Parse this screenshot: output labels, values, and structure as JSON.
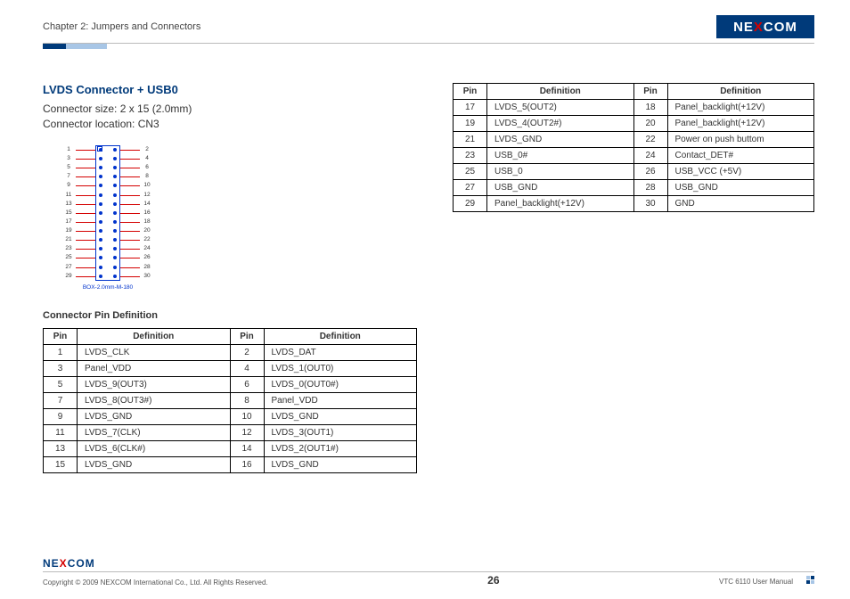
{
  "header": {
    "chapter": "Chapter 2: Jumpers and Connectors",
    "logo": "NEXCOM"
  },
  "section": {
    "title": "LVDS Connector + USB0",
    "size_line": "Connector size:  2 x 15 (2.0mm)",
    "loc_line": "Connector location: CN3",
    "diagram_label": "BOX-2.0mm-M-180",
    "pin_def_title": "Connector Pin Definition"
  },
  "table_headers": {
    "pin": "Pin",
    "def": "Definition"
  },
  "table1": [
    {
      "p1": "1",
      "d1": "LVDS_CLK",
      "p2": "2",
      "d2": "LVDS_DAT"
    },
    {
      "p1": "3",
      "d1": "Panel_VDD",
      "p2": "4",
      "d2": "LVDS_1(OUT0)"
    },
    {
      "p1": "5",
      "d1": "LVDS_9(OUT3)",
      "p2": "6",
      "d2": "LVDS_0(OUT0#)"
    },
    {
      "p1": "7",
      "d1": "LVDS_8(OUT3#)",
      "p2": "8",
      "d2": "Panel_VDD"
    },
    {
      "p1": "9",
      "d1": "LVDS_GND",
      "p2": "10",
      "d2": "LVDS_GND"
    },
    {
      "p1": "11",
      "d1": "LVDS_7(CLK)",
      "p2": "12",
      "d2": "LVDS_3(OUT1)"
    },
    {
      "p1": "13",
      "d1": "LVDS_6(CLK#)",
      "p2": "14",
      "d2": "LVDS_2(OUT1#)"
    },
    {
      "p1": "15",
      "d1": "LVDS_GND",
      "p2": "16",
      "d2": "LVDS_GND"
    }
  ],
  "table2": [
    {
      "p1": "17",
      "d1": "LVDS_5(OUT2)",
      "p2": "18",
      "d2": "Panel_backlight(+12V)"
    },
    {
      "p1": "19",
      "d1": "LVDS_4(OUT2#)",
      "p2": "20",
      "d2": "Panel_backlight(+12V)"
    },
    {
      "p1": "21",
      "d1": "LVDS_GND",
      "p2": "22",
      "d2": "Power on push buttom"
    },
    {
      "p1": "23",
      "d1": "USB_0#",
      "p2": "24",
      "d2": "Contact_DET#"
    },
    {
      "p1": "25",
      "d1": "USB_0",
      "p2": "26",
      "d2": "USB_VCC (+5V)"
    },
    {
      "p1": "27",
      "d1": "USB_GND",
      "p2": "28",
      "d2": "USB_GND"
    },
    {
      "p1": "29",
      "d1": "Panel_backlight(+12V)",
      "p2": "30",
      "d2": "GND"
    }
  ],
  "footer": {
    "logo": "NEXCOM",
    "copyright": "Copyright © 2009 NEXCOM International Co., Ltd. All Rights Reserved.",
    "page": "26",
    "manual": "VTC 6110 User Manual"
  }
}
